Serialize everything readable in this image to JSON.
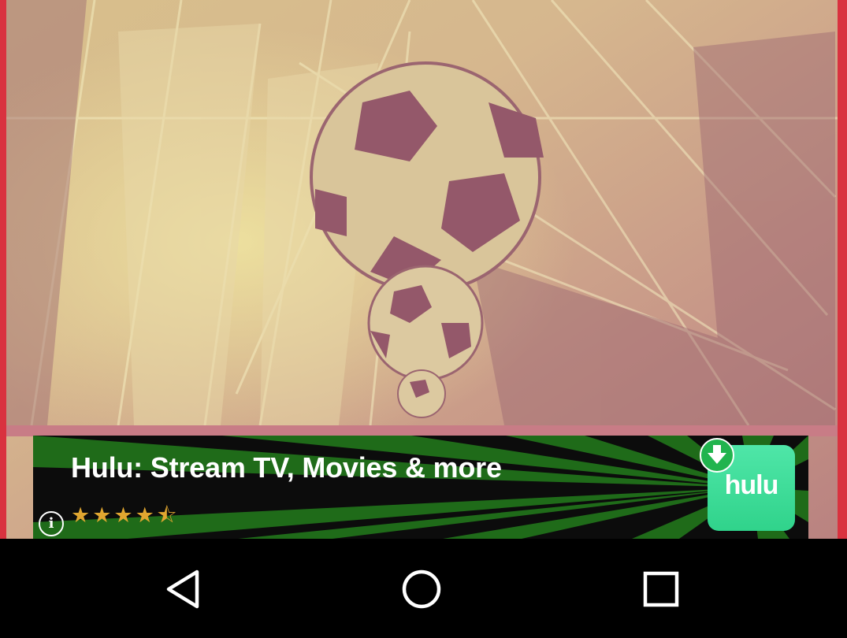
{
  "ad": {
    "title": "Hulu: Stream TV, Movies & more",
    "rating_value": 4.5,
    "rating_max": 5,
    "rating_stars": "★★★★⯪",
    "info_icon": "i",
    "logo_text": "hulu",
    "icons": {
      "info": "info-icon",
      "download": "download-arrow-icon",
      "logo": "hulu-logo"
    }
  },
  "navbar": {
    "icons": {
      "back": "back-triangle-icon",
      "home": "home-circle-icon",
      "recents": "recents-square-icon"
    }
  },
  "colors": {
    "frame_accent": "#d9323f",
    "ad_green": "#1f6b19",
    "hulu_green": "#3ddc97",
    "star_gold": "#e0a630",
    "navbar_bg": "#000000"
  }
}
